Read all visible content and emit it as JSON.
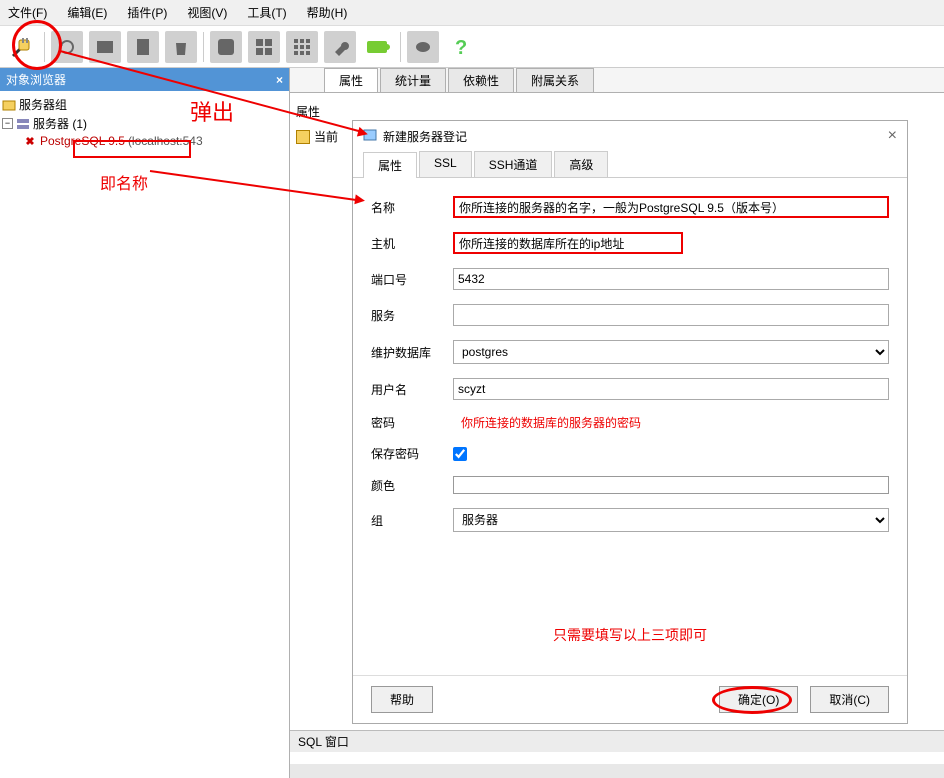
{
  "menu": {
    "file": "文件(F)",
    "edit": "编辑(E)",
    "plugin": "插件(P)",
    "view": "视图(V)",
    "tools": "工具(T)",
    "help": "帮助(H)"
  },
  "sidebar": {
    "title": "对象浏览器",
    "close": "×",
    "root": "服务器组",
    "servers": "服务器 (1)",
    "server_item": "PostgreSQL 9.5",
    "server_host": "(localhost:543"
  },
  "content_tabs": {
    "tab1": "属性",
    "tab2": "统计量",
    "tab3": "依赖性",
    "tab4": "附属关系"
  },
  "content": {
    "prop_label": "属性",
    "current_label": "当前"
  },
  "dialog": {
    "title": "新建服务器登记",
    "close": "×",
    "tabs": {
      "prop": "属性",
      "ssl": "SSL",
      "ssh": "SSH通道",
      "adv": "高级"
    },
    "labels": {
      "name": "名称",
      "host": "主机",
      "port": "端口号",
      "service": "服务",
      "maintdb": "维护数据库",
      "user": "用户名",
      "password": "密码",
      "savepwd": "保存密码",
      "color": "颜色",
      "group": "组"
    },
    "values": {
      "name": "你所连接的服务器的名字，一般为PostgreSQL 9.5（版本号）",
      "host": "你所连接的数据库所在的ip地址",
      "port": "5432",
      "service": "",
      "maintdb": "postgres",
      "user": "scyzt",
      "group": "服务器"
    },
    "pwd_hint": "你所连接的数据库的服务器的密码",
    "buttons": {
      "help": "帮助",
      "ok": "确定(O)",
      "cancel": "取消(C)"
    }
  },
  "bottom": {
    "sql": "SQL 窗口"
  },
  "annotations": {
    "popup": "弹出",
    "name": "即名称",
    "note": "只需要填写以上三项即可"
  }
}
